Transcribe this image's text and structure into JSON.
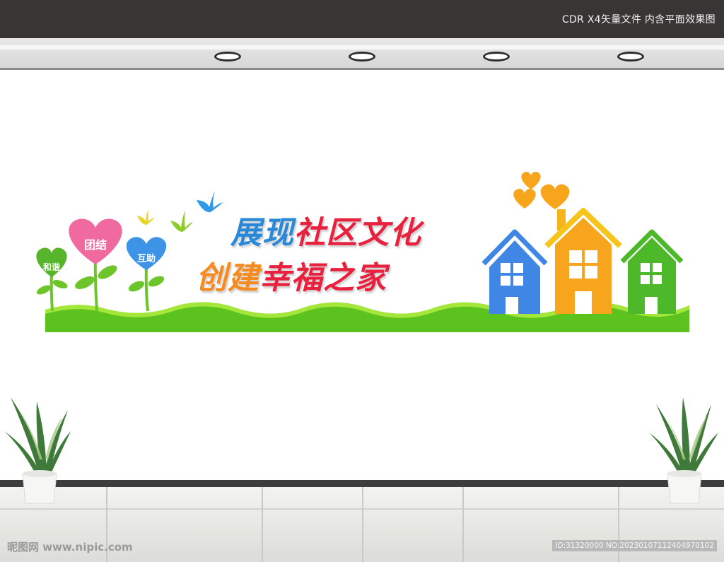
{
  "topbar": {
    "text": "CDR X4矢量文件  内含平面效果图"
  },
  "sign": {
    "line1_part1": "展现",
    "line1_part2": "社区文化",
    "line2_part1": "创建",
    "line2_part2": "幸福之家",
    "hearts": [
      "和谐",
      "团结",
      "互助"
    ]
  },
  "watermark": {
    "left": "昵图网 www.nipic.com",
    "right": "ID:31320000 NO:20230107112404970102"
  },
  "colors": {
    "blue": "#2a88d8",
    "red": "#e8213f",
    "orange": "#f58a1f",
    "green": "#5cc21d",
    "pink": "#f06aa0"
  }
}
